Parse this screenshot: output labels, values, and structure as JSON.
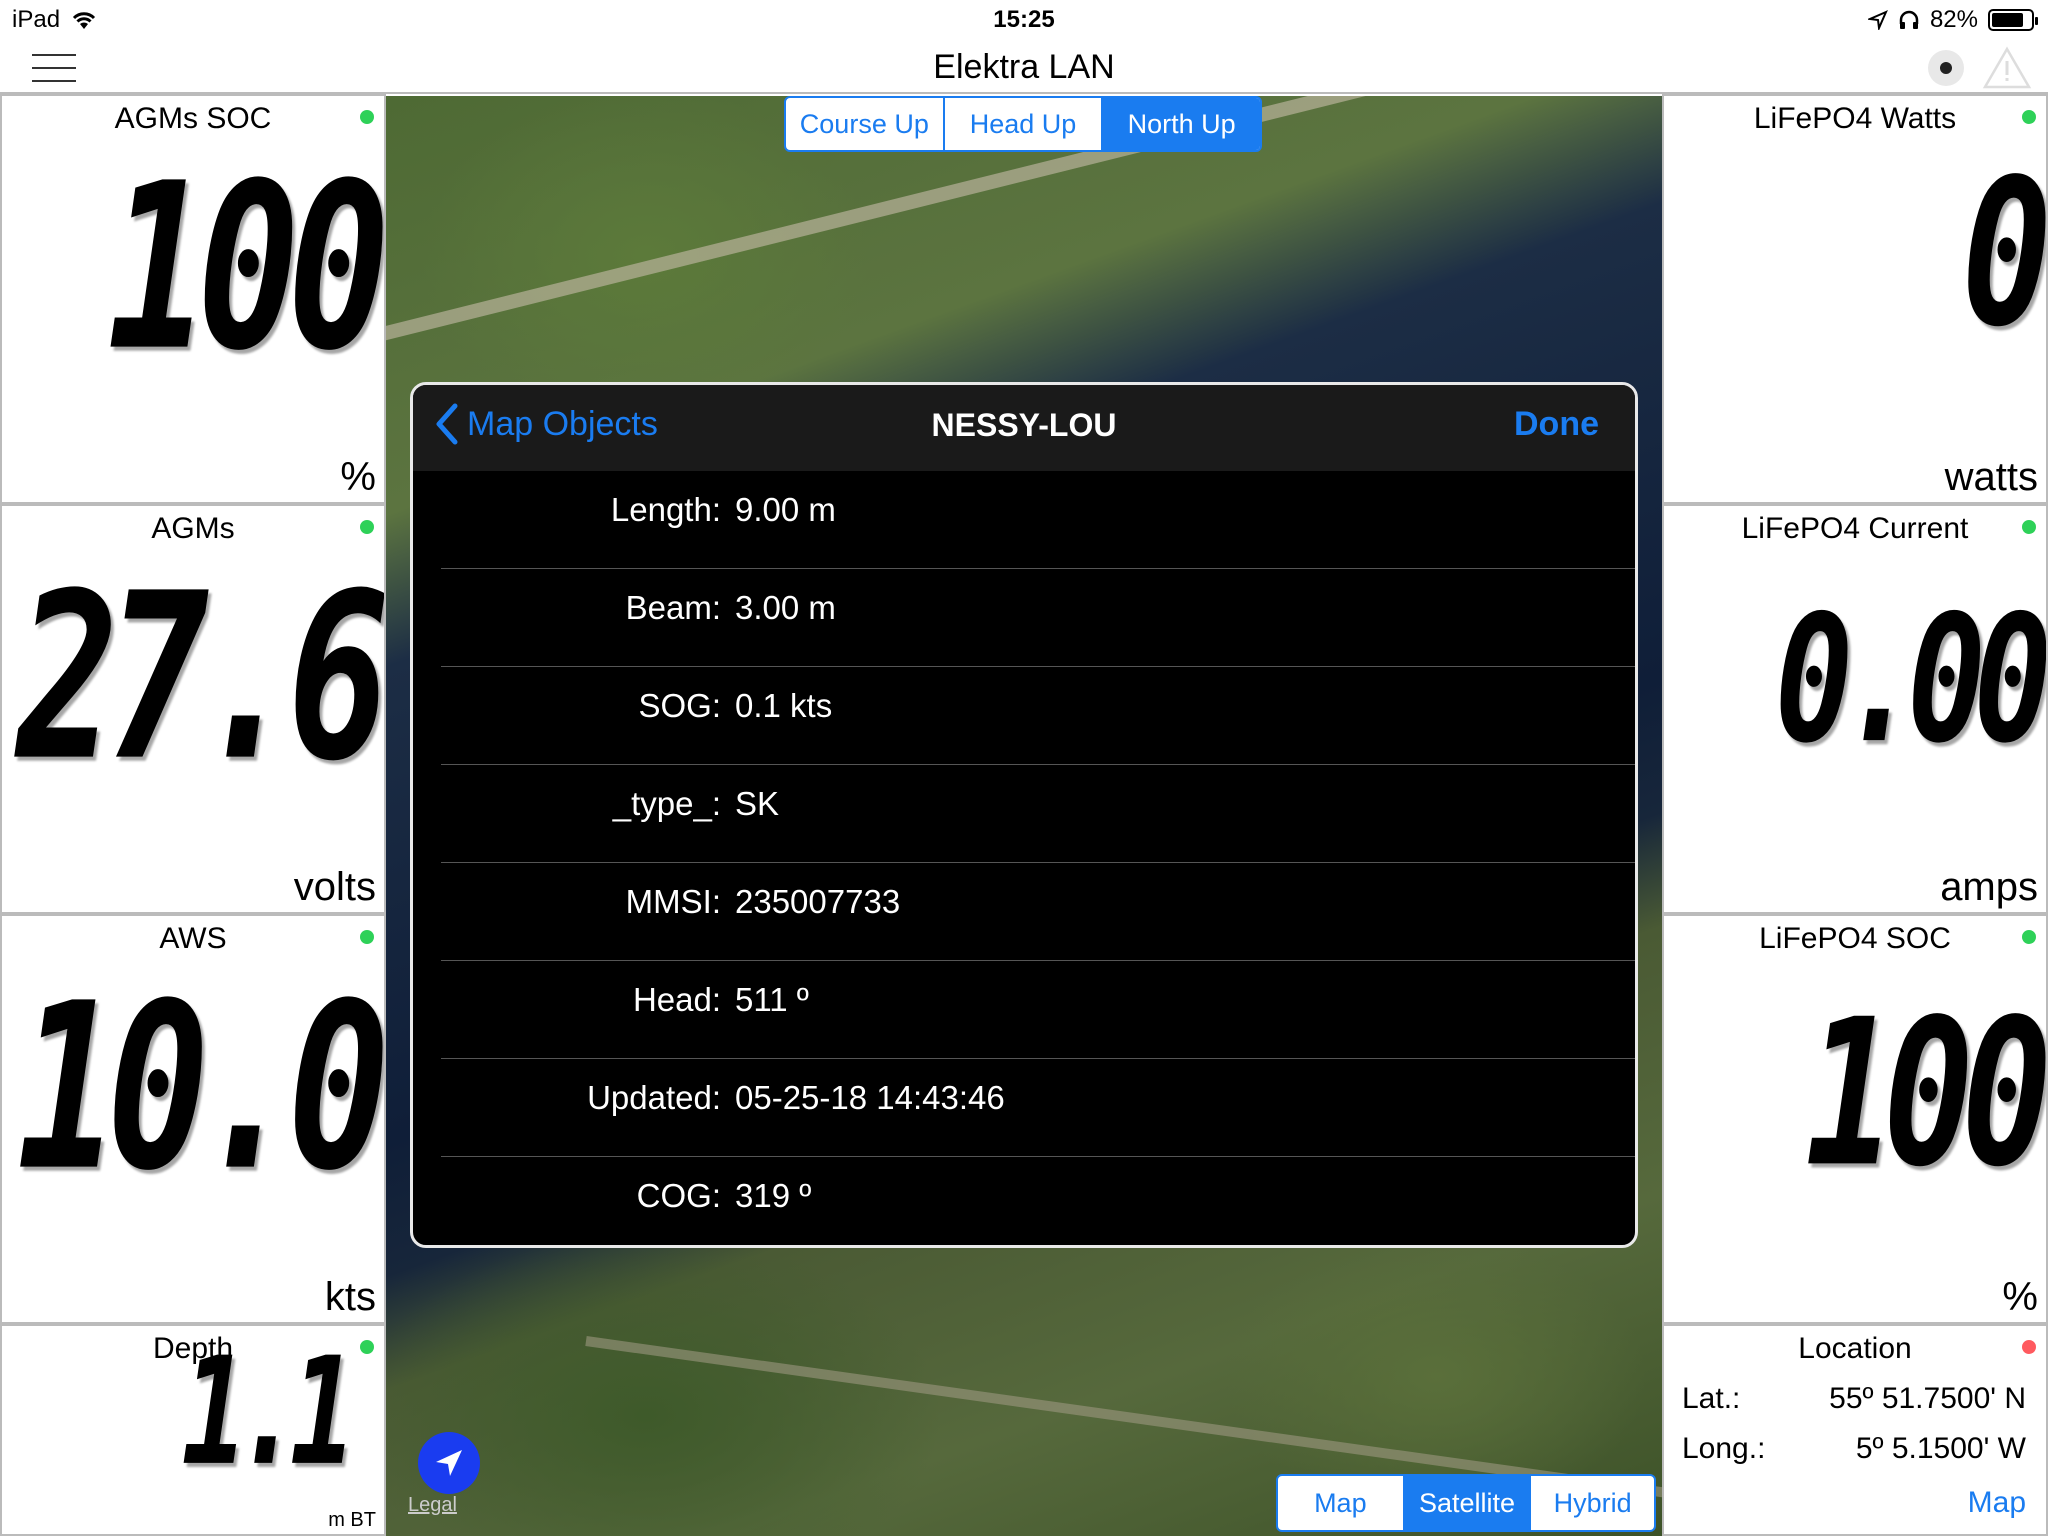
{
  "status": {
    "device": "iPad",
    "time": "15:25",
    "battery": "82%",
    "battery_level": 0.82
  },
  "nav": {
    "title": "Elektra LAN"
  },
  "left_tiles": [
    {
      "title": "AGMs SOC",
      "value": "100",
      "unit": "%"
    },
    {
      "title": "AGMs",
      "value": "27.6",
      "unit": "volts"
    },
    {
      "title": "AWS",
      "value": "10.0",
      "unit": "kts"
    },
    {
      "title": "Depth",
      "value": "1.1",
      "unit": "m BT"
    }
  ],
  "right_tiles": [
    {
      "title": "LiFePO4 Watts",
      "value": "0",
      "unit": "watts"
    },
    {
      "title": "LiFePO4 Current",
      "value": "0.00",
      "unit": "amps"
    },
    {
      "title": "LiFePO4 SOC",
      "value": "100",
      "unit": "%"
    }
  ],
  "location": {
    "title": "Location",
    "lat_label": "Lat.:",
    "lat_value": "55º 51.7500' N",
    "long_label": "Long.:",
    "long_value": "5º 5.1500' W",
    "link": "Map"
  },
  "orientation": {
    "course_up": "Course Up",
    "head_up": "Head Up",
    "north_up": "North Up",
    "selected": "North Up"
  },
  "map_type": {
    "map": "Map",
    "satellite": "Satellite",
    "hybrid": "Hybrid",
    "selected": "Satellite"
  },
  "map": {
    "legal": "Legal"
  },
  "popover": {
    "back": "Map Objects",
    "title": "NESSY-LOU",
    "done": "Done",
    "rows": [
      {
        "key": "Length:",
        "value": "9.00 m"
      },
      {
        "key": "Beam:",
        "value": "3.00 m"
      },
      {
        "key": "SOG:",
        "value": "0.1 kts"
      },
      {
        "key": "_type_:",
        "value": "SK"
      },
      {
        "key": "MMSI:",
        "value": "235007733"
      },
      {
        "key": "Head:",
        "value": "511 º"
      },
      {
        "key": "Updated:",
        "value": "05-25-18 14:43:46"
      },
      {
        "key": "COG:",
        "value": "319 º"
      }
    ]
  },
  "colors": {
    "accent": "#1a7cf0",
    "status_ok": "#2ed158",
    "status_err": "#ff5a5f"
  }
}
